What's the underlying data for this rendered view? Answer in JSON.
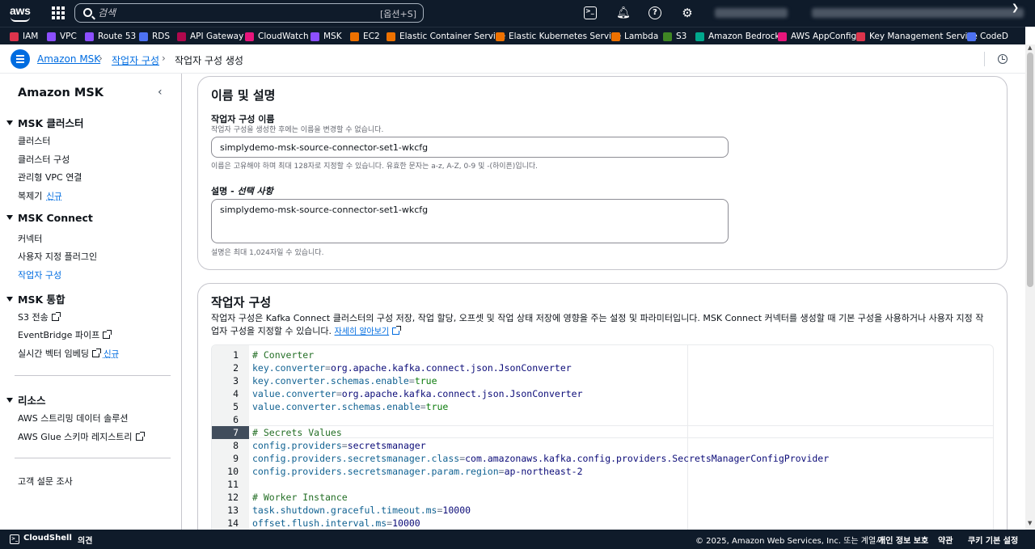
{
  "topnav": {
    "logo": "aws",
    "search_placeholder": "검색",
    "search_shortcut": "[옵션+S]",
    "icons": [
      "cloudshell-icon",
      "bell-icon",
      "help-icon",
      "settings-icon"
    ]
  },
  "favorites": [
    {
      "label": "IAM",
      "color": "#dd344c"
    },
    {
      "label": "VPC",
      "color": "#8c4fff"
    },
    {
      "label": "Route 53",
      "color": "#8c4fff"
    },
    {
      "label": "RDS",
      "color": "#4d72f3"
    },
    {
      "label": "API Gateway",
      "color": "#b0084d"
    },
    {
      "label": "CloudWatch",
      "color": "#e7157b"
    },
    {
      "label": "MSK",
      "color": "#8c4fff"
    },
    {
      "label": "EC2",
      "color": "#ed7100"
    },
    {
      "label": "Elastic Container Service",
      "color": "#ed7100"
    },
    {
      "label": "Elastic Kubernetes Service",
      "color": "#ed7100"
    },
    {
      "label": "Lambda",
      "color": "#ed7100"
    },
    {
      "label": "S3",
      "color": "#3f8624"
    },
    {
      "label": "Amazon Bedrock",
      "color": "#01a88d"
    },
    {
      "label": "AWS AppConfig",
      "color": "#e7157b"
    },
    {
      "label": "Key Management Service",
      "color": "#dd344c"
    },
    {
      "label": "CodeD",
      "color": "#4d72f3"
    }
  ],
  "breadcrumb": {
    "items": [
      "Amazon MSK",
      "작업자 구성",
      "작업자 구성 생성"
    ],
    "separator": "›"
  },
  "sidebar": {
    "title": "Amazon MSK",
    "sections": [
      {
        "title": "MSK 클러스터",
        "items": [
          "클러스터",
          "클러스터 구성",
          "관리형 VPC 연결",
          "복제기"
        ]
      },
      {
        "title": "MSK Connect",
        "items": [
          "커넥터",
          "사용자 지정 플러그인",
          "작업자 구성"
        ]
      },
      {
        "title": "MSK 통합",
        "items": [
          "S3 전송",
          "EventBridge 파이프",
          "실시간 벡터 임베딩"
        ]
      },
      {
        "title": "리소스",
        "items": [
          "AWS 스트리밍 데이터 솔루션",
          "AWS Glue 스키마 레지스트리"
        ]
      }
    ],
    "new_badge": "신규",
    "survey": "고객 설문 조사"
  },
  "name_section": {
    "title": "이름 및 설명",
    "name_label": "작업자 구성 이름",
    "name_desc": "작업자 구성을 생성한 후에는 이름을 변경할 수 없습니다.",
    "name_value": "simplydemo-msk-source-connector-set1-wkcfg",
    "name_constraint": "이름은 고유해야 하며 최대 128자로 지정할 수 있습니다. 유효한 문자는 a-z, A-Z, 0-9 및 -(하이픈)입니다.",
    "desc_label": "설명",
    "desc_optional": "선택 사항",
    "desc_value": "simplydemo-msk-source-connector-set1-wkcfg",
    "desc_constraint": "설명은 최대 1,024자일 수 있습니다."
  },
  "config_section": {
    "title": "작업자 구성",
    "description": "작업자 구성은 Kafka Connect 클러스터의 구성 저장, 작업 할당, 오프셋 및 작업 상태 저장에 영향을 주는 설정 및 파라미터입니다. MSK Connect 커넥터를 생성할 때 기본 구성을 사용하거나 사용자 지정 작업자 구성을 지정할 수 있습니다.",
    "learn_more": "자세히 알아보기",
    "active_line": 7,
    "lines": [
      {
        "n": "1",
        "type": "comment",
        "text": "# Converter"
      },
      {
        "n": "2",
        "type": "kv",
        "key": "key.converter",
        "value": "org.apache.kafka.connect.json.JsonConverter"
      },
      {
        "n": "3",
        "type": "kv",
        "key": "key.converter.schemas.enable",
        "value": "true"
      },
      {
        "n": "4",
        "type": "kv",
        "key": "value.converter",
        "value": "org.apache.kafka.connect.json.JsonConverter"
      },
      {
        "n": "5",
        "type": "kv",
        "key": "value.converter.schemas.enable",
        "value": "true"
      },
      {
        "n": "6",
        "type": "blank",
        "text": ""
      },
      {
        "n": "7",
        "type": "comment",
        "text": "# Secrets Values"
      },
      {
        "n": "8",
        "type": "kv",
        "key": "config.providers",
        "value": "secretsmanager"
      },
      {
        "n": "9",
        "type": "kv",
        "key": "config.providers.secretsmanager.class",
        "value": "com.amazonaws.kafka.config.providers.SecretsManagerConfigProvider"
      },
      {
        "n": "10",
        "type": "kv",
        "key": "config.providers.secretsmanager.param.region",
        "value": "ap-northeast-2"
      },
      {
        "n": "11",
        "type": "blank",
        "text": ""
      },
      {
        "n": "12",
        "type": "comment",
        "text": "# Worker Instance"
      },
      {
        "n": "13",
        "type": "kv",
        "key": "task.shutdown.graceful.timeout.ms",
        "value": "10000"
      },
      {
        "n": "14",
        "type": "kv",
        "key": "offset.flush.interval.ms",
        "value": "10000"
      }
    ]
  },
  "footer": {
    "cloudshell": "CloudShell",
    "feedback": "의견",
    "copyright": "© 2025, Amazon Web Services, Inc. 또는 계열사.",
    "privacy": "개인 정보 보호",
    "terms": "약관",
    "cookies": "쿠키 기본 설정"
  }
}
